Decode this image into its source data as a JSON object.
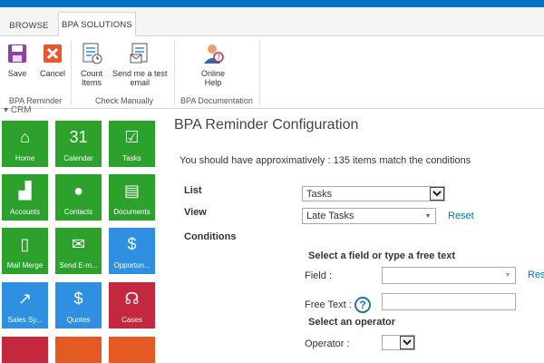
{
  "tabs": [
    {
      "label": "BROWSE"
    },
    {
      "label": "BPA SOLUTIONS"
    }
  ],
  "ribbon": {
    "buttons": {
      "save": "Save",
      "cancel": "Cancel",
      "count_items": "Count\nItems",
      "send_test": "Send me a test\nemail",
      "online_help": "Online\nHelp"
    },
    "groups": {
      "reminder": "BPA Reminder",
      "check": "Check Manually",
      "docs": "BPA Documentation"
    }
  },
  "sidebar": {
    "header": "CRM",
    "tiles": [
      {
        "label": "Home",
        "icon": "home-icon",
        "glyph": "⌂"
      },
      {
        "label": "Calendar",
        "icon": "calendar-icon",
        "glyph": "31"
      },
      {
        "label": "Tasks",
        "icon": "tasks-icon",
        "glyph": "☑"
      },
      {
        "label": "Accounts",
        "icon": "accounts-icon",
        "glyph": "▟"
      },
      {
        "label": "Contacts",
        "icon": "contacts-icon",
        "glyph": "●"
      },
      {
        "label": "Documents",
        "icon": "documents-icon",
        "glyph": "▤"
      },
      {
        "label": "Mail Merge",
        "icon": "mail-merge-icon",
        "glyph": "▯"
      },
      {
        "label": "Send E-m...",
        "icon": "envelope-icon",
        "glyph": "✉"
      },
      {
        "label": "Opportun...",
        "icon": "dollar-icon",
        "glyph": "$"
      },
      {
        "label": "Sales Sy...",
        "icon": "chart-icon",
        "glyph": "↗"
      },
      {
        "label": "Quotes",
        "icon": "quotes-icon",
        "glyph": "$"
      },
      {
        "label": "Cases",
        "icon": "headset-icon",
        "glyph": "☊"
      }
    ]
  },
  "main": {
    "title": "BPA Reminder Configuration",
    "approx_text": "You should have approximatively : 135 items match the conditions",
    "labels": {
      "list": "List",
      "view": "View",
      "conditions": "Conditions"
    },
    "list_value": "Tasks",
    "view_value": "Late Tasks",
    "reset": "Reset",
    "reset_truncated": "Rese",
    "select_field_heading": "Select a field or type a free text",
    "field_label": "Field :",
    "free_text_label": "Free Text :",
    "select_operator_heading": "Select an operator",
    "operator_label": "Operator :"
  },
  "colors": {
    "accent": "#0072c6",
    "tile_green": "#2ca12c",
    "tile_blue": "#2f8fe0",
    "tile_red": "#c4283e",
    "tile_orange": "#e35a25"
  }
}
